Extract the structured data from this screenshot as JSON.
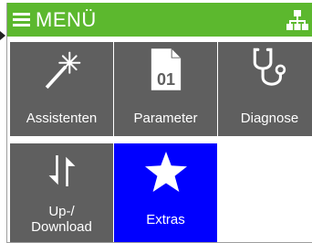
{
  "header": {
    "title": "MENÜ",
    "menu_icon": "hamburger-icon",
    "nav_icon": "sitemap-icon",
    "color": "#5cb82e"
  },
  "tiles": [
    {
      "label": "Assistenten",
      "icon": "magic-wand-icon",
      "active": false
    },
    {
      "label": "Parameter",
      "icon": "document-01-icon",
      "active": false
    },
    {
      "label": "Diagnose",
      "icon": "stethoscope-icon",
      "active": false
    },
    {
      "label_line1": "Up-/",
      "label_line2": "Download",
      "icon": "up-down-arrows-icon",
      "active": false
    },
    {
      "label": "Extras",
      "icon": "star-icon",
      "active": true
    }
  ],
  "colors": {
    "tile": "#5f5f5f",
    "tile_active": "#0000ff",
    "text": "#ffffff"
  }
}
